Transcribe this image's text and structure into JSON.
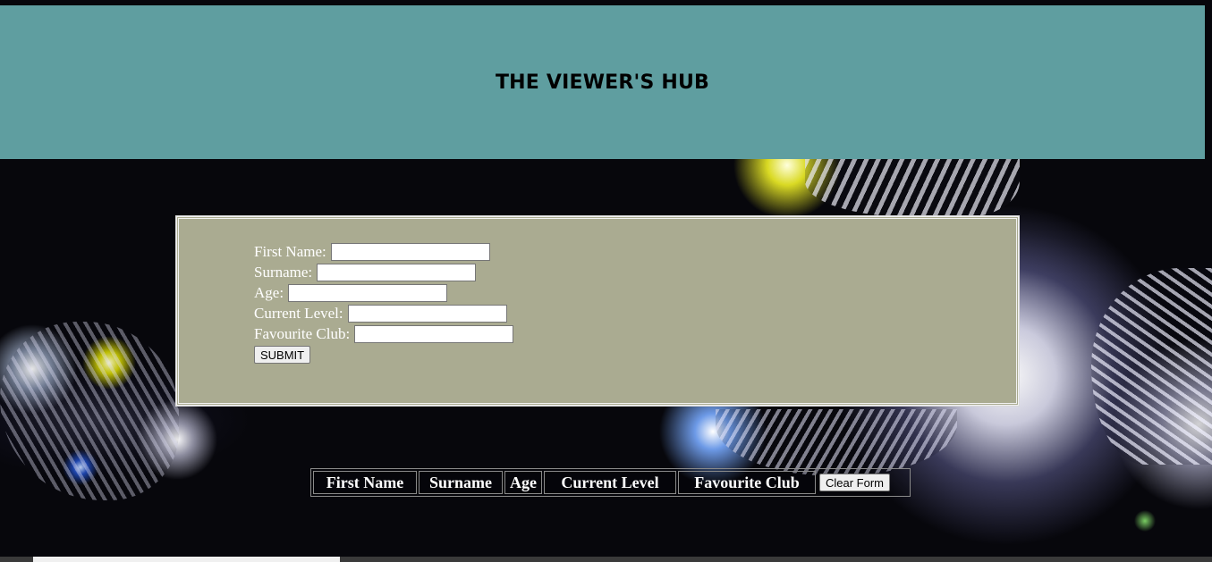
{
  "header": {
    "title": "THE VIEWER'S HUB"
  },
  "form": {
    "fields": [
      {
        "label": "First Name:",
        "value": ""
      },
      {
        "label": "Surname:",
        "value": ""
      },
      {
        "label": "Age:",
        "value": ""
      },
      {
        "label": "Current Level:",
        "value": ""
      },
      {
        "label": "Favourite Club:",
        "value": ""
      }
    ],
    "submit_label": "SUBMIT"
  },
  "table": {
    "columns": [
      "First Name",
      "Surname",
      "Age",
      "Current Level",
      "Favourite Club"
    ],
    "clear_label": "Clear Form"
  },
  "colors": {
    "header_bg": "#5f9ea0",
    "form_bg": "#aaab91"
  }
}
